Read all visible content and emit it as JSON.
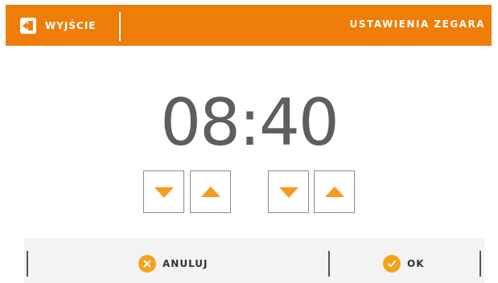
{
  "header": {
    "exit_label": "WYJŚCIE",
    "title": "USTAWIENIA ZEGARA"
  },
  "clock": {
    "time": "08:40"
  },
  "controls": {
    "hours_down_icon": "triangle-down-icon",
    "hours_up_icon": "triangle-up-icon",
    "minutes_down_icon": "triangle-down-icon",
    "minutes_up_icon": "triangle-up-icon"
  },
  "footer": {
    "cancel_label": "ANULUJ",
    "ok_label": "OK"
  },
  "colors": {
    "accent": "#ef7d0a",
    "arrow": "#f79a1e",
    "action_icon": "#f7a21b",
    "clock_text": "#5e5e5e"
  }
}
